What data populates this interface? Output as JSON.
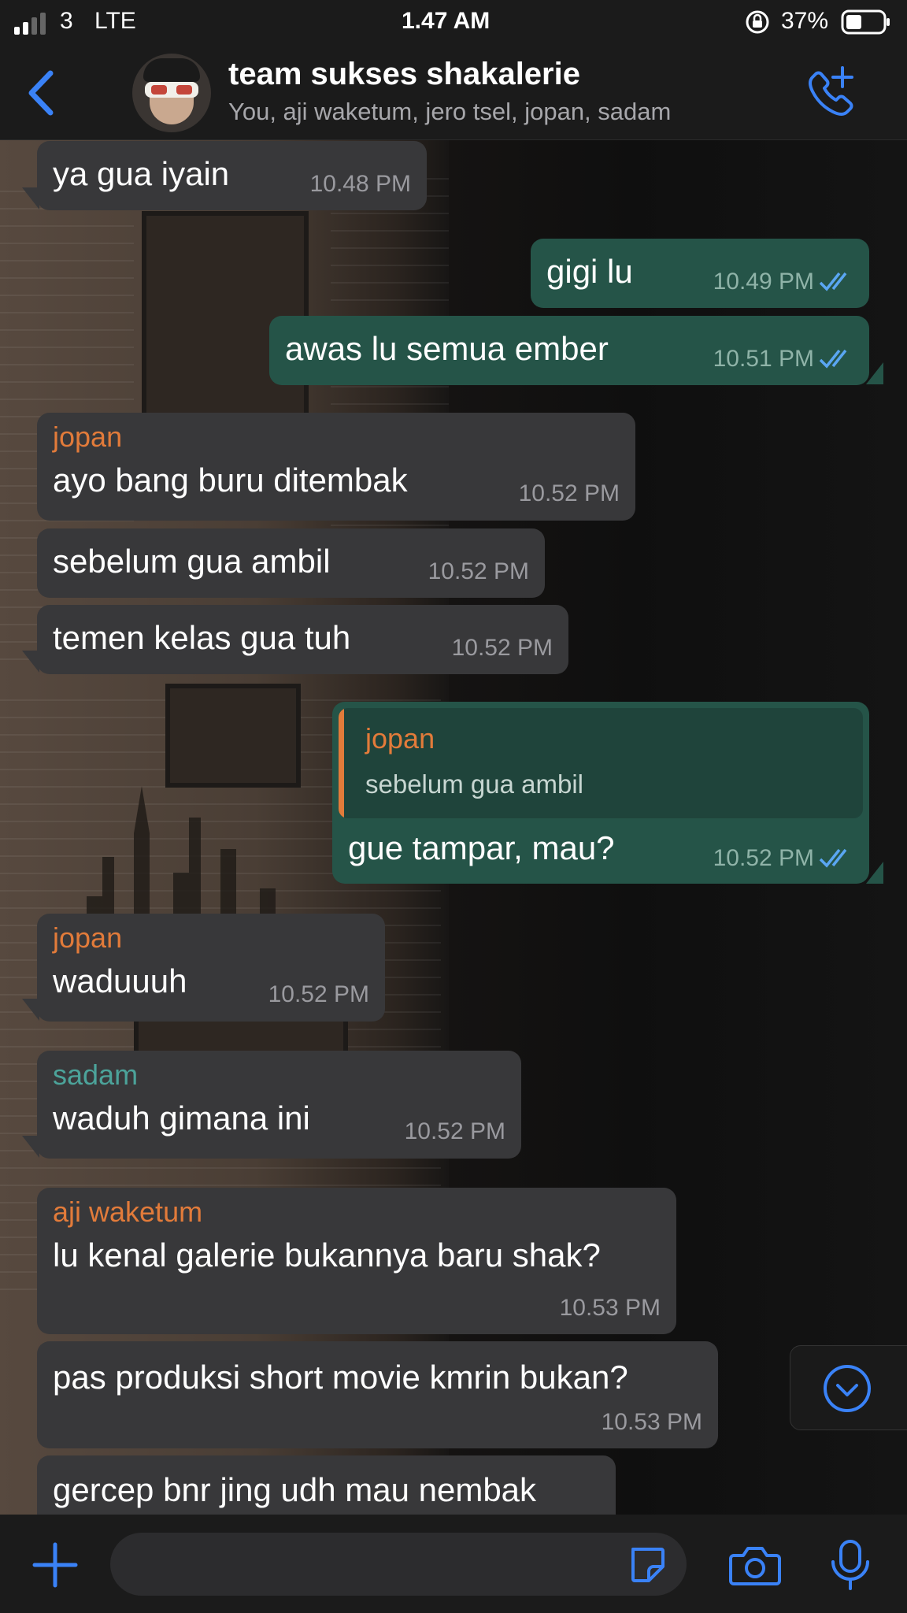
{
  "status": {
    "carrier": "3",
    "network": "LTE",
    "time": "1.47 AM",
    "battery": "37%"
  },
  "header": {
    "title": "team sukses shakalerie",
    "subtitle": "You, aji waketum, jero tsel, jopan, sadam"
  },
  "colors": {
    "accent": "#3a82f7",
    "incoming_bubble": "#38383a",
    "outgoing_bubble": "#255448",
    "sender_orange": "#e27b3a",
    "sender_teal": "#4ca39a",
    "read_ticks": "#5aa6f2"
  },
  "messages": [
    {
      "text": "ya gua iyain",
      "time": "10.48 PM"
    },
    {
      "text": "gigi lu",
      "time": "10.49 PM"
    },
    {
      "text": "awas lu semua ember",
      "time": "10.51 PM"
    },
    {
      "sender": "jopan",
      "text": "ayo bang buru ditembak",
      "time": "10.52 PM"
    },
    {
      "text": "sebelum gua ambil",
      "time": "10.52 PM"
    },
    {
      "text": "temen kelas gua tuh",
      "time": "10.52 PM"
    },
    {
      "reply_sender": "jopan",
      "reply_text": "sebelum gua ambil",
      "text": "gue tampar, mau?",
      "time": "10.52 PM"
    },
    {
      "sender": "jopan",
      "text": "waduuuh",
      "time": "10.52 PM"
    },
    {
      "sender": "sadam",
      "text": "waduh gimana ini",
      "time": "10.52 PM"
    },
    {
      "sender": "aji waketum",
      "text": "lu kenal galerie bukannya baru shak?",
      "time": "10.53 PM"
    },
    {
      "text": "pas produksi short movie kmrin bukan?",
      "time": "10.53 PM"
    },
    {
      "text": "gercep bnr jing udh mau nembak"
    }
  ],
  "icons": {
    "back": "chevron-left-icon",
    "call": "add-call-icon",
    "scroll": "scroll-down-icon",
    "plus": "plus-icon",
    "sticker": "sticker-icon",
    "camera": "camera-icon",
    "mic": "microphone-icon"
  }
}
